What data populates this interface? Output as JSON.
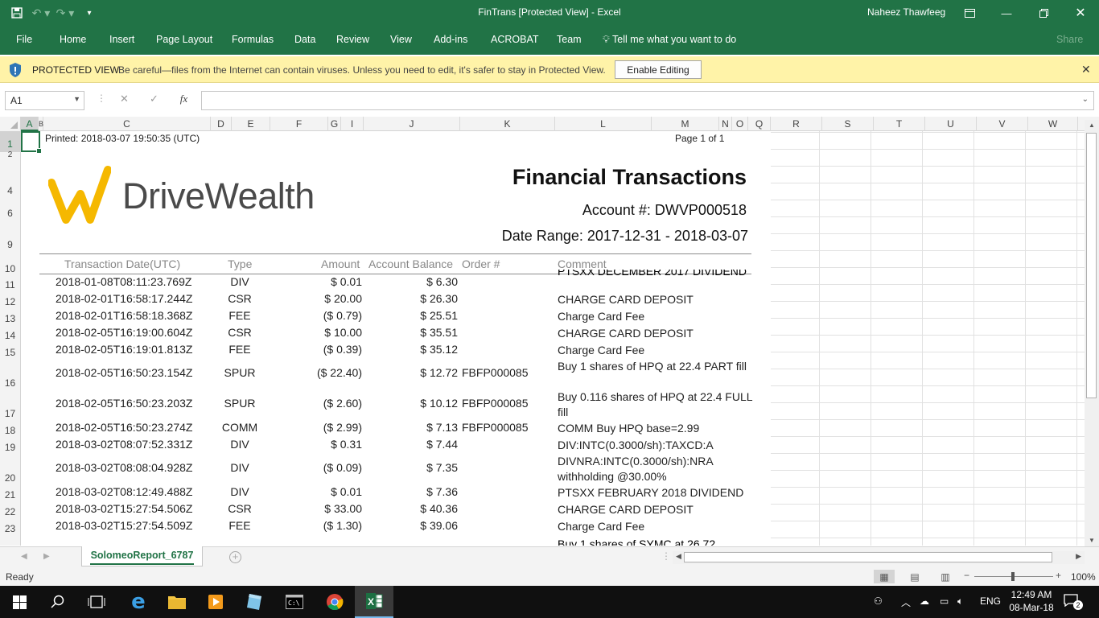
{
  "titlebar": {
    "title": "FinTrans  [Protected View]  -  Excel",
    "user": "Naheez Thawfeeg"
  },
  "ribbon": {
    "tabs": [
      "File",
      "Home",
      "Insert",
      "Page Layout",
      "Formulas",
      "Data",
      "Review",
      "View",
      "Add-ins",
      "ACROBAT",
      "Team"
    ],
    "tell_me": "Tell me what you want to do",
    "share": "Share"
  },
  "protected_view": {
    "title": "PROTECTED VIEW",
    "message": "Be careful—files from the Internet can contain viruses. Unless you need to edit, it's safer to stay in Protected View.",
    "enable_button": "Enable Editing"
  },
  "formula_bar": {
    "name_box": "A1",
    "fx": "fx",
    "value": ""
  },
  "columns": [
    "A",
    "B",
    "C",
    "D",
    "E",
    "F",
    "G",
    "I",
    "J",
    "K",
    "L",
    "M",
    "N",
    "O",
    "Q",
    "R",
    "S",
    "T",
    "U",
    "V",
    "W"
  ],
  "rows": [
    "1",
    "2",
    "4",
    "6",
    "9",
    "10",
    "11",
    "12",
    "13",
    "14",
    "15",
    "16",
    "17",
    "18",
    "19",
    "20",
    "21",
    "22",
    "23"
  ],
  "report": {
    "printed": "Printed: 2018-03-07 19:50:35 (UTC)",
    "page_info": "Page 1 of    1",
    "logo_text": "DriveWealth",
    "title": "Financial Transactions",
    "account": "Account #: DWVP000518",
    "date_range": "Date Range: 2017-12-31 - 2018-03-07",
    "headers": {
      "date": "Transaction Date(UTC)",
      "type": "Type",
      "amount": "Amount",
      "balance": "Account Balance",
      "order": "Order #",
      "comment": "Comment"
    },
    "first_comment_partial": "PTSXX DECEMBER 2017 DIVIDEND",
    "last_comment_partial": "Buy 1 shares of SYMC at 26.72",
    "transactions": [
      {
        "date": "2018-01-08T08:11:23.769Z",
        "type": "DIV",
        "amount": "$ 0.01",
        "balance": "$ 6.30",
        "order": "",
        "comment": ""
      },
      {
        "date": "2018-02-01T16:58:17.244Z",
        "type": "CSR",
        "amount": "$ 20.00",
        "balance": "$ 26.30",
        "order": "",
        "comment": "CHARGE CARD DEPOSIT"
      },
      {
        "date": "2018-02-01T16:58:18.368Z",
        "type": "FEE",
        "amount": "($ 0.79)",
        "balance": "$ 25.51",
        "order": "",
        "comment": "Charge Card Fee"
      },
      {
        "date": "2018-02-05T16:19:00.604Z",
        "type": "CSR",
        "amount": "$ 10.00",
        "balance": "$ 35.51",
        "order": "",
        "comment": "CHARGE CARD DEPOSIT"
      },
      {
        "date": "2018-02-05T16:19:01.813Z",
        "type": "FEE",
        "amount": "($ 0.39)",
        "balance": "$ 35.12",
        "order": "",
        "comment": "Charge Card Fee"
      },
      {
        "date": "2018-02-05T16:50:23.154Z",
        "type": "SPUR",
        "amount": "($ 22.40)",
        "balance": "$ 12.72",
        "order": "FBFP000085",
        "comment": "Buy 1 shares of HPQ at 22.4 PART fill"
      },
      {
        "date": "2018-02-05T16:50:23.203Z",
        "type": "SPUR",
        "amount": "($ 2.60)",
        "balance": "$ 10.12",
        "order": "FBFP000085",
        "comment": "Buy 0.116 shares of HPQ at 22.4 FULL fill"
      },
      {
        "date": "2018-02-05T16:50:23.274Z",
        "type": "COMM",
        "amount": "($ 2.99)",
        "balance": "$ 7.13",
        "order": "FBFP000085",
        "comment": "COMM Buy HPQ base=2.99"
      },
      {
        "date": "2018-03-02T08:07:52.331Z",
        "type": "DIV",
        "amount": "$ 0.31",
        "balance": "$ 7.44",
        "order": "",
        "comment": "DIV:INTC(0.3000/sh):TAXCD:A"
      },
      {
        "date": "2018-03-02T08:08:04.928Z",
        "type": "DIV",
        "amount": "($ 0.09)",
        "balance": "$ 7.35",
        "order": "",
        "comment": "DIVNRA:INTC(0.3000/sh):NRA withholding @30.00%"
      },
      {
        "date": "2018-03-02T08:12:49.488Z",
        "type": "DIV",
        "amount": "$ 0.01",
        "balance": "$ 7.36",
        "order": "",
        "comment": "PTSXX FEBRUARY 2018 DIVIDEND"
      },
      {
        "date": "2018-03-02T15:27:54.506Z",
        "type": "CSR",
        "amount": "$ 33.00",
        "balance": "$ 40.36",
        "order": "",
        "comment": "CHARGE CARD DEPOSIT"
      },
      {
        "date": "2018-03-02T15:27:54.509Z",
        "type": "FEE",
        "amount": "($ 1.30)",
        "balance": "$ 39.06",
        "order": "",
        "comment": "Charge Card Fee"
      }
    ]
  },
  "sheet_tab": "SolomeoReport_6787",
  "status": {
    "ready": "Ready",
    "zoom": "100%"
  },
  "taskbar": {
    "lang": "ENG",
    "time": "12:49 AM",
    "date": "08-Mar-18",
    "notification_count": "2"
  },
  "colors": {
    "excel_green": "#217346",
    "protected_bar": "#fff3a8",
    "logo_yellow": "#f5b800"
  }
}
